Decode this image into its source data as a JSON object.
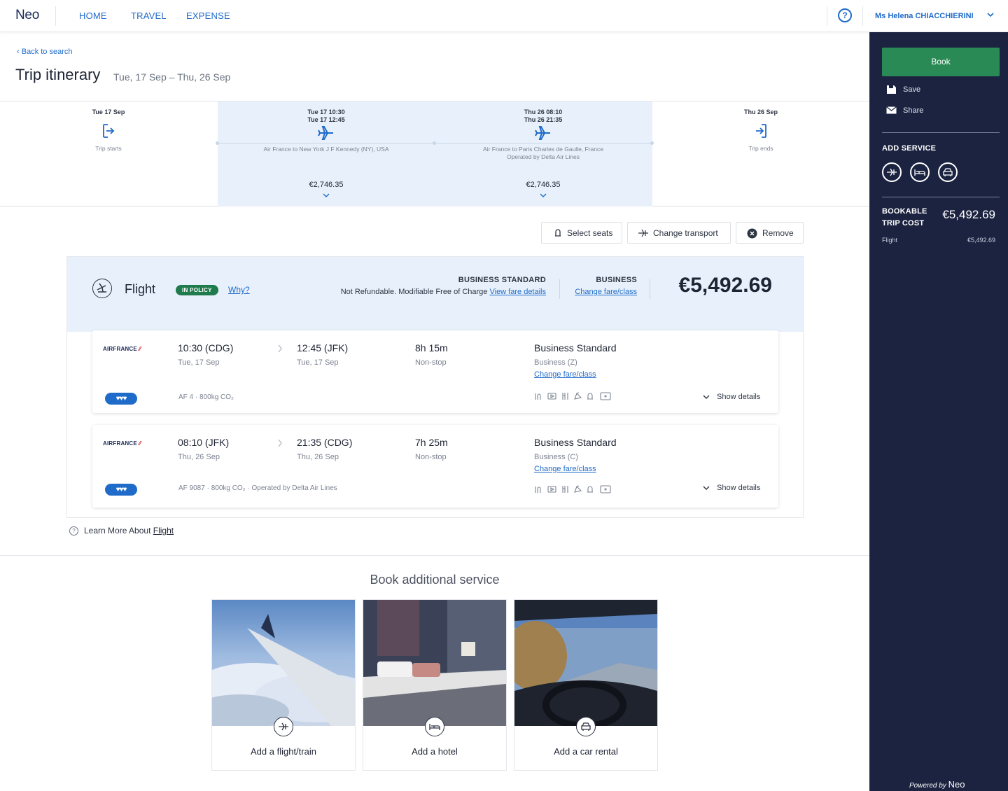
{
  "header": {
    "logo": "Neo",
    "nav": [
      "HOME",
      "TRAVEL",
      "EXPENSE"
    ],
    "help": "?",
    "user": "Ms Helena CHIACCHIERINI"
  },
  "page": {
    "back": "Back to search",
    "title": "Trip itinerary",
    "dates": "Tue, 17 Sep – Thu, 26 Sep"
  },
  "timeline": {
    "start": {
      "date": "Tue 17 Sep",
      "label": "Trip starts"
    },
    "out": {
      "date1": "Tue 17   10:30",
      "date2": "Tue 17   12:45",
      "desc": "Air France to New York J F Kennedy (NY), USA",
      "price": "€2,746.35"
    },
    "ret": {
      "date1": "Thu 26   08:10",
      "date2": "Thu 26   21:35",
      "desc1": "Air France to Paris Charles de Gaulle, France",
      "desc2": "Operated by Delta Air Lines",
      "price": "€2,746.35"
    },
    "end": {
      "date": "Thu 26 Sep",
      "label": "Trip ends"
    }
  },
  "actions": {
    "seats": "Select seats",
    "transport": "Change transport",
    "remove": "Remove"
  },
  "flight": {
    "title": "Flight",
    "policy": "IN POLICY",
    "why": "Why?",
    "fare1_title": "BUSINESS STANDARD",
    "fare1_text": "Not Refundable. Modifiable Free of Charge",
    "fare1_link": "View fare details",
    "fare2_title": "BUSINESS",
    "fare2_link": "Change fare/class",
    "total": "€5,492.69",
    "segments": [
      {
        "airline": "AIRFRANCE",
        "dep_time": "10:30 (CDG)",
        "dep_date": "Tue, 17 Sep",
        "arr_time": "12:45 (JFK)",
        "arr_date": "Tue, 17 Sep",
        "duration": "8h 15m",
        "stops": "Non-stop",
        "fare": "Business Standard",
        "cls": "Business (Z)",
        "change": "Change fare/class",
        "info": "AF 4 · 800kg CO₂",
        "show": "Show details",
        "hearts": "♥♥♥"
      },
      {
        "airline": "AIRFRANCE",
        "dep_time": "08:10 (JFK)",
        "dep_date": "Thu, 26 Sep",
        "arr_time": "21:35 (CDG)",
        "arr_date": "Thu, 26 Sep",
        "duration": "7h 25m",
        "stops": "Non-stop",
        "fare": "Business Standard",
        "cls": "Business (C)",
        "change": "Change fare/class",
        "info": "AF 9087 · 800kg CO₂ · Operated by Delta Air Lines",
        "show": "Show details",
        "hearts": "♥♥♥"
      }
    ],
    "learn_prefix": "Learn More About ",
    "learn_link": "Flight"
  },
  "additional": {
    "title": "Book additional service",
    "cards": [
      "Add a flight/train",
      "Add a hotel",
      "Add a car rental"
    ]
  },
  "sidebar": {
    "book": "Book",
    "save": "Save",
    "share": "Share",
    "add_service": "ADD SERVICE",
    "cost_label_1": "BOOKABLE",
    "cost_label_2": "TRIP COST",
    "cost_value": "€5,492.69",
    "flight_label": "Flight",
    "flight_value": "€5,492.69",
    "powered_prefix": "Powered by ",
    "powered_brand": "Neo"
  },
  "colors": {
    "accent": "#1f6bc9",
    "sidebar": "#1c2340",
    "book": "#2a8a56",
    "policy": "#1f7a4c",
    "highlight": "#e8f1fb"
  }
}
